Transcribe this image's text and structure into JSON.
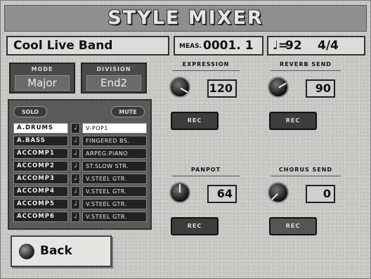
{
  "header": {
    "title": "STYLE MIXER"
  },
  "info": {
    "song_name": "Cool Live Band",
    "meas_label": "MEAS.",
    "meas_value": "0001. 1",
    "tempo_icon": "♩=",
    "tempo_value": "92",
    "beat_value": "4/4"
  },
  "mode": {
    "label": "MODE",
    "value": "Major"
  },
  "division": {
    "label": "DIVISION",
    "value": "End2"
  },
  "track_panel": {
    "solo_label": "SOLO",
    "mute_label": "MUTE",
    "note_glyph": "♩",
    "tracks": [
      {
        "part": "A.DRUMS",
        "tone": "V-POP1"
      },
      {
        "part": "A.BASS",
        "tone": "FINGERED BS."
      },
      {
        "part": "ACCOMP1",
        "tone": "ARPEG.PIANO"
      },
      {
        "part": "ACCOMP2",
        "tone": "ST.SLOW STR."
      },
      {
        "part": "ACCOMP3",
        "tone": "V.STEEL GTR."
      },
      {
        "part": "ACCOMP4",
        "tone": "V.STEEL GTR."
      },
      {
        "part": "ACCOMP5",
        "tone": "V.STEEL GTR."
      },
      {
        "part": "ACCOMP6",
        "tone": "V.STEEL GTR."
      }
    ]
  },
  "params": {
    "expression": {
      "label": "EXPRESSION",
      "value": "120",
      "rec_label": "REC"
    },
    "reverb": {
      "label": "REVERB SEND",
      "value": "90",
      "rec_label": "REC"
    },
    "panpot": {
      "label": "PANPOT",
      "value": "64",
      "rec_label": "REC"
    },
    "chorus": {
      "label": "CHORUS SEND",
      "value": "0",
      "rec_label": "REC"
    }
  },
  "footer": {
    "back_label": "Back"
  },
  "icons": {
    "knob": "knob-icon",
    "back": "back-icon"
  },
  "colors": {
    "background": "#c9c9c6",
    "title_bar": "#8f8f8d",
    "panel": "#5a5a5a",
    "track_active": "#ffffff"
  }
}
